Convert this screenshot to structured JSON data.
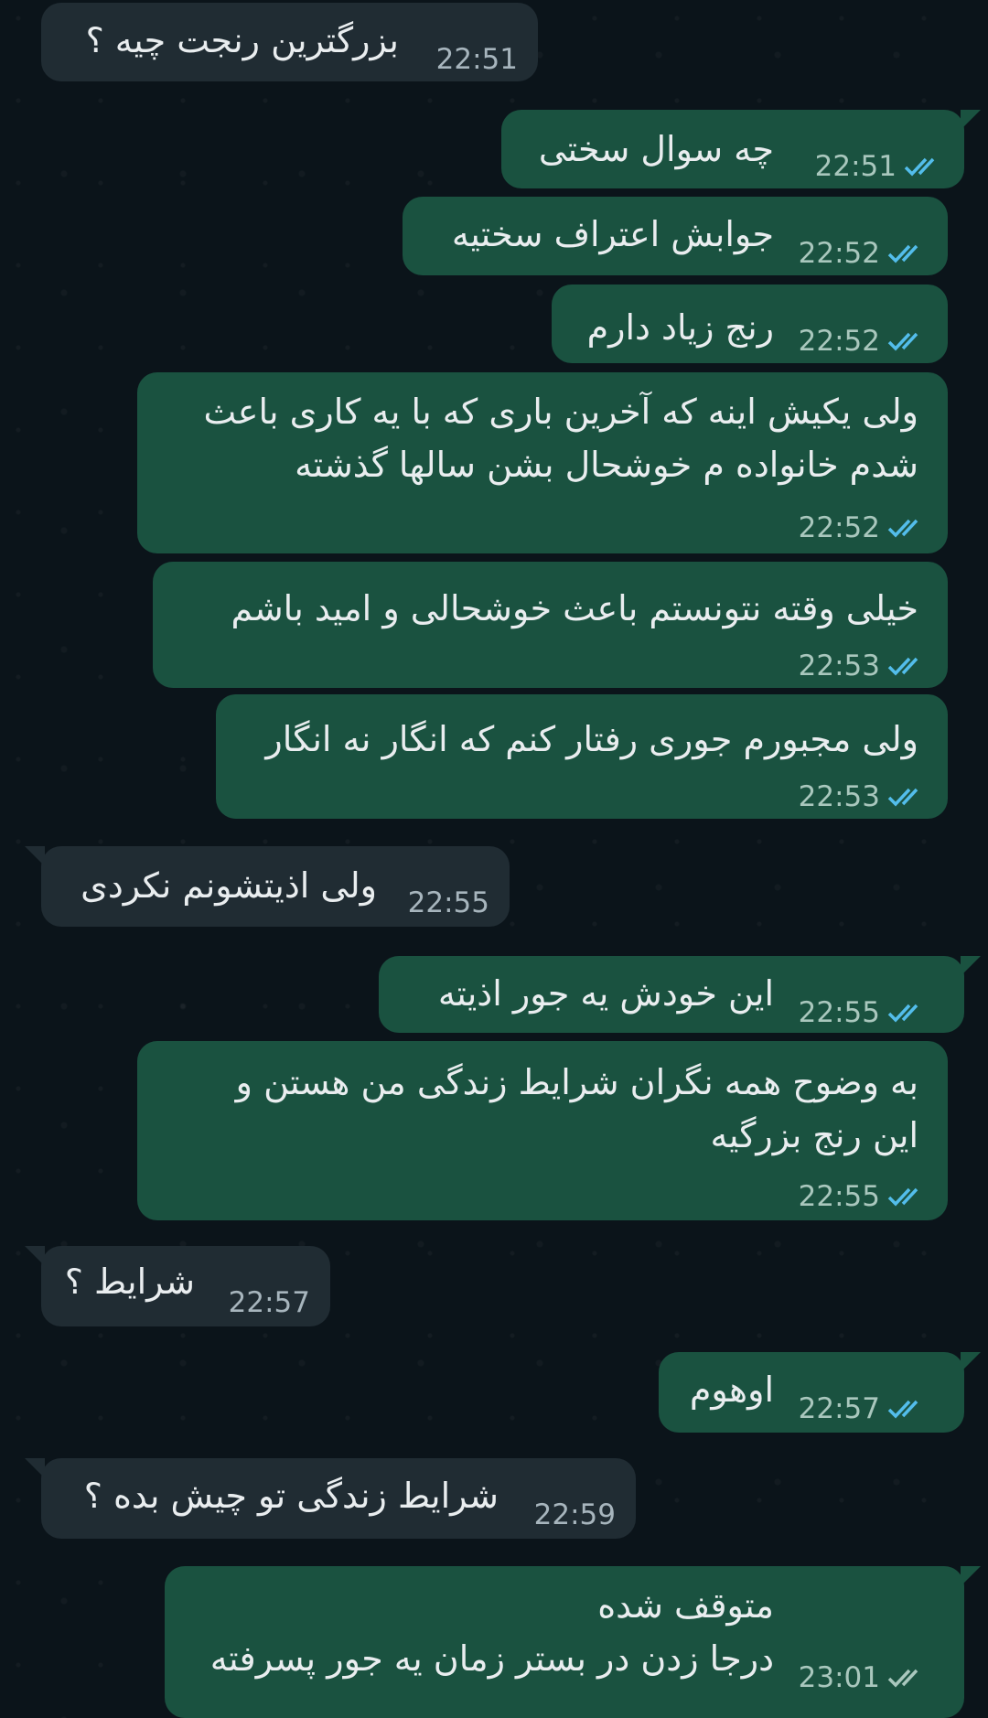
{
  "messages": [
    {
      "dir": "in",
      "text": [
        "بزرگترین رنجت چیه ؟"
      ],
      "time": "22:51"
    },
    {
      "dir": "out",
      "text": [
        "چه سوال سختی"
      ],
      "time": "22:51",
      "status": "read"
    },
    {
      "dir": "out",
      "text": [
        "جوابش اعتراف سختیه"
      ],
      "time": "22:52",
      "status": "read"
    },
    {
      "dir": "out",
      "text": [
        "رنج زیاد دارم"
      ],
      "time": "22:52",
      "status": "read"
    },
    {
      "dir": "out",
      "text": [
        "ولی یکیش اینه که آخرین باری که با یه کاری باعث",
        "شدم خانواده م خوشحال بشن سالها گذشته"
      ],
      "time": "22:52",
      "status": "read"
    },
    {
      "dir": "out",
      "text": [
        "خیلی وقته نتونستم باعث خوشحالی و امید باشم"
      ],
      "time": "22:53",
      "status": "read"
    },
    {
      "dir": "out",
      "text": [
        "ولی مجبورم جوری رفتار کنم که انگار نه انگار"
      ],
      "time": "22:53",
      "status": "read"
    },
    {
      "dir": "in",
      "text": [
        "ولی اذیتشونم نکردی"
      ],
      "time": "22:55"
    },
    {
      "dir": "out",
      "text": [
        "این خودش یه جور اذیته"
      ],
      "time": "22:55",
      "status": "read"
    },
    {
      "dir": "out",
      "text": [
        "به وضوح همه نگران شرایط زندگی من هستن و",
        "این رنج بزرگیه"
      ],
      "time": "22:55",
      "status": "read"
    },
    {
      "dir": "in",
      "text": [
        "شرایط ؟"
      ],
      "time": "22:57"
    },
    {
      "dir": "out",
      "text": [
        "اوهوم"
      ],
      "time": "22:57",
      "status": "read"
    },
    {
      "dir": "in",
      "text": [
        "شرایط زندگی تو چیش بده ؟"
      ],
      "time": "22:59"
    },
    {
      "dir": "out",
      "text": [
        "متوقف شده",
        "درجا زدن در بستر زمان یه جور پسرفته"
      ],
      "time": "23:01",
      "status": "delivered"
    }
  ],
  "colors": {
    "background": "#0b141a",
    "incoming_bubble": "#202c33",
    "outgoing_bubble": "#1a5240",
    "read_tick": "#53bdeb",
    "delivered_tick": "#a9c7bd"
  },
  "icons": {
    "read": "double-check-icon",
    "delivered": "double-check-icon"
  }
}
